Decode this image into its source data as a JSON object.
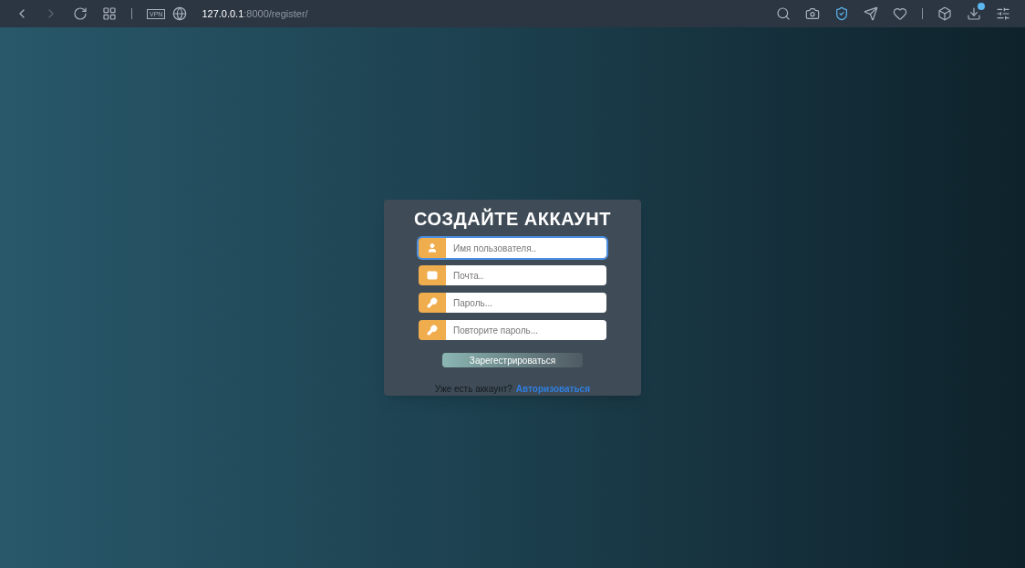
{
  "browser": {
    "vpn_badge": "VPN",
    "url_host": "127.0.0.1",
    "url_rest": ":8000/register/"
  },
  "form": {
    "title": "СОЗДАЙТЕ АККАУНТ",
    "fields": [
      {
        "kind": "user",
        "placeholder": "Имя пользователя..",
        "focused": true
      },
      {
        "kind": "mail",
        "placeholder": "Почта..",
        "focused": false
      },
      {
        "kind": "key",
        "placeholder": "Пароль...",
        "focused": false
      },
      {
        "kind": "key",
        "placeholder": "Повторите пароль...",
        "focused": false
      }
    ],
    "submit": "Зарегестрироваться",
    "footer_text": "Уже есть аккаунт?",
    "footer_link": "Авторизоваться"
  }
}
